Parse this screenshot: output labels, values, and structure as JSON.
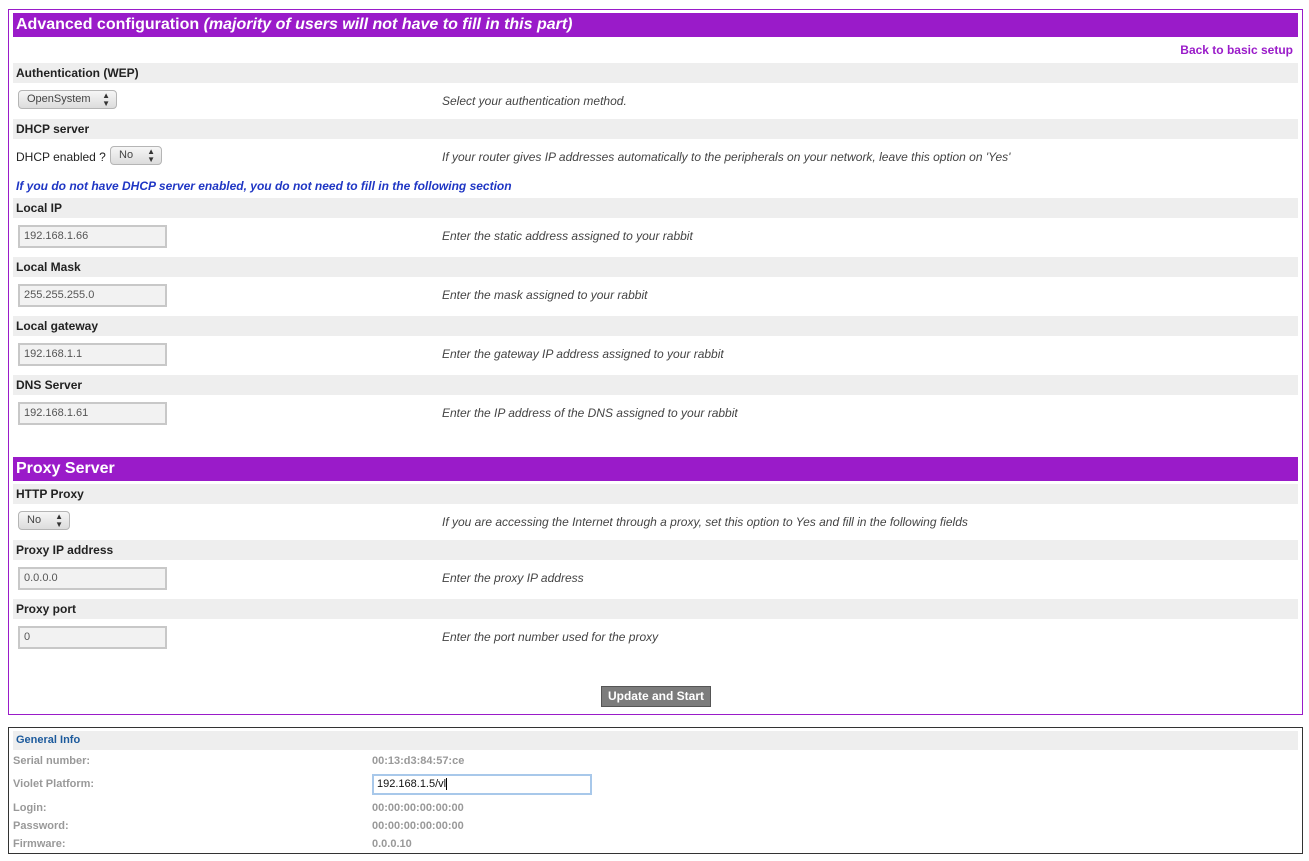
{
  "advanced": {
    "title": "Advanced configuration",
    "subtitle": "(majority of users will not have to fill in this part)",
    "back_link": "Back to basic setup",
    "auth": {
      "label": "Authentication (WEP)",
      "select_value": "OpenSystem",
      "hint": "Select your authentication method."
    },
    "dhcp": {
      "label": "DHCP server",
      "field_label": "DHCP enabled ?",
      "select_value": "No",
      "hint": "If your router gives IP addresses automatically to the peripherals on your network, leave this option on 'Yes'"
    },
    "note": "If you do not have DHCP server enabled, you do not need to fill in the following section",
    "local_ip": {
      "label": "Local IP",
      "value": "192.168.1.66",
      "hint": "Enter the static address assigned to your rabbit"
    },
    "local_mask": {
      "label": "Local Mask",
      "value": "255.255.255.0",
      "hint": "Enter the mask assigned to your rabbit"
    },
    "local_gateway": {
      "label": "Local gateway",
      "value": "192.168.1.1",
      "hint": "Enter the gateway IP address assigned to your rabbit"
    },
    "dns_server": {
      "label": "DNS Server",
      "value": "192.168.1.61",
      "hint": "Enter the IP address of the DNS assigned to your rabbit"
    }
  },
  "proxy": {
    "title": "Proxy Server",
    "http_proxy": {
      "label": "HTTP Proxy",
      "select_value": "No",
      "hint": "If you are accessing the Internet through a proxy, set this option to Yes and fill in the following fields"
    },
    "ip": {
      "label": "Proxy IP address",
      "value": "0.0.0.0",
      "hint": "Enter the proxy IP address"
    },
    "port": {
      "label": "Proxy port",
      "value": "0",
      "hint": "Enter the port number used for the proxy"
    },
    "submit_label": "Update and Start"
  },
  "general_info": {
    "title": "General Info",
    "serial_label": "Serial number:",
    "serial_value": "00:13:d3:84:57:ce",
    "platform_label": "Violet Platform:",
    "platform_value": "192.168.1.5/vl",
    "login_label": "Login:",
    "login_value": "00:00:00:00:00:00",
    "password_label": "Password:",
    "password_value": "00:00:00:00:00:00",
    "firmware_label": "Firmware:",
    "firmware_value": "0.0.0.10"
  },
  "colors": {
    "accent": "#9a1bc9",
    "note_blue": "#1f36c4",
    "info_title": "#1c5a9c"
  },
  "icons": {
    "select_arrows": "up-down-arrows-icon"
  }
}
